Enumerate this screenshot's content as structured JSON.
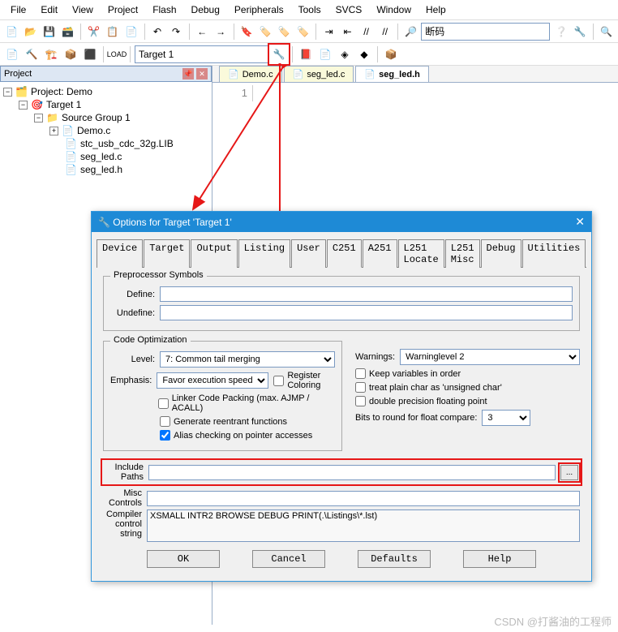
{
  "menubar": [
    "File",
    "Edit",
    "View",
    "Project",
    "Flash",
    "Debug",
    "Peripherals",
    "Tools",
    "SVCS",
    "Window",
    "Help"
  ],
  "toolbar2": {
    "target_selector": "Target 1",
    "combo2": "断码"
  },
  "project_panel": {
    "title": "Project",
    "root": "Project: Demo",
    "target": "Target 1",
    "group": "Source Group 1",
    "files": [
      "Demo.c",
      "stc_usb_cdc_32g.LIB",
      "seg_led.c",
      "seg_led.h"
    ]
  },
  "editor": {
    "tabs": [
      "Demo.c",
      "seg_led.c",
      "seg_led.h"
    ],
    "active_tab": "seg_led.h",
    "line_number": "1"
  },
  "dialog": {
    "title": "Options for Target 'Target 1'",
    "tabs": [
      "Device",
      "Target",
      "Output",
      "Listing",
      "User",
      "C251",
      "A251",
      "L251 Locate",
      "L251 Misc",
      "Debug",
      "Utilities"
    ],
    "active_tab": "C251",
    "preproc": {
      "legend": "Preprocessor Symbols",
      "define_lbl": "Define:",
      "undefine_lbl": "Undefine:",
      "define": "",
      "undefine": ""
    },
    "codeopt": {
      "legend": "Code Optimization",
      "level_lbl": "Level:",
      "level": "7: Common tail merging",
      "emph_lbl": "Emphasis:",
      "emph": "Favor execution speed",
      "regcolor": "Register Coloring",
      "linker": "Linker Code Packing (max. AJMP / ACALL)",
      "reentrant": "Generate reentrant functions",
      "alias": "Alias checking on pointer accesses"
    },
    "right": {
      "warn_lbl": "Warnings:",
      "warn": "Warninglevel 2",
      "keep": "Keep variables in order",
      "plainchar": "treat plain char as 'unsigned char'",
      "double": "double precision floating point",
      "bits_lbl": "Bits to round for float compare:",
      "bits": "3"
    },
    "include_lbl": "Include Paths",
    "include": "",
    "misc_lbl": "Misc Controls",
    "misc": "",
    "compiler_lbl": "Compiler control string",
    "compiler": "XSMALL INTR2 BROWSE DEBUG PRINT(.\\Listings\\*.lst)",
    "buttons": {
      "ok": "OK",
      "cancel": "Cancel",
      "defaults": "Defaults",
      "help": "Help"
    }
  },
  "watermark": "CSDN @打酱油的工程师"
}
